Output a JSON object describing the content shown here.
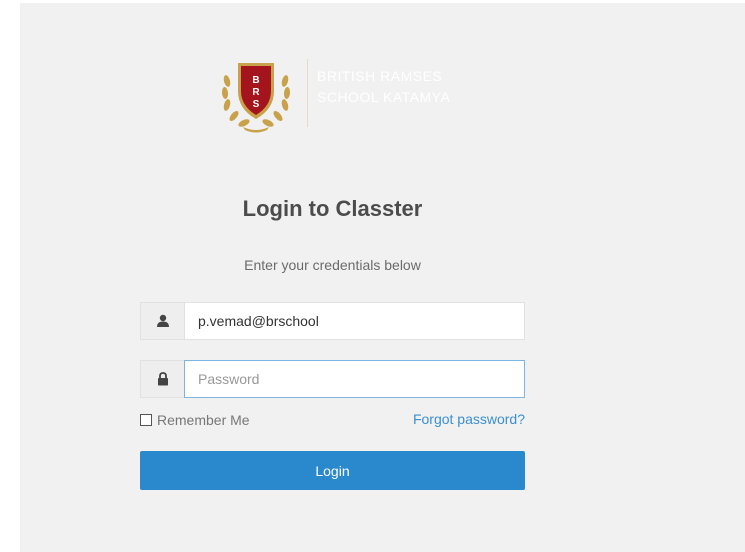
{
  "logo": {
    "name_line1": "BRITISH RAMSES",
    "name_line2": "SCHOOL KATAMYA",
    "crest_letters": "BRS"
  },
  "title": "Login to Classter",
  "subtitle": "Enter your credentials below",
  "username": {
    "value": "p.vemad@brschool",
    "icon": "user-icon"
  },
  "password": {
    "placeholder": "Password",
    "icon": "lock-icon"
  },
  "remember_label": "Remember Me",
  "forgot_label": "Forgot password?",
  "login_label": "Login",
  "colors": {
    "accent": "#2a88cc",
    "link": "#3b8fd0",
    "crest_red": "#a3141c",
    "crest_gold": "#c9a14a"
  }
}
